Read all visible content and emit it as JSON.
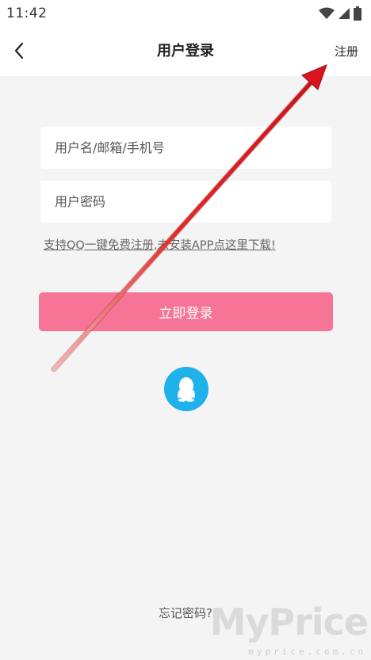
{
  "status_bar": {
    "time": "11:42",
    "icons": [
      "wifi-icon",
      "signal-icon",
      "battery-icon"
    ]
  },
  "nav": {
    "back_icon": "chevron-left-icon",
    "title": "用户登录",
    "register_label": "注册"
  },
  "form": {
    "username_placeholder": "用户名/邮箱/手机号",
    "username_value": "",
    "password_placeholder": "用户密码",
    "password_value": "",
    "qq_hint": "支持QQ一键免费注册,未安装APP点这里下载!",
    "login_label": "立即登录",
    "qq_login_icon": "qq-penguin-icon",
    "forgot_label": "忘记密码?"
  },
  "watermark": {
    "logo": "MyPrice",
    "domain": "myprice.com.cn"
  },
  "colors": {
    "accent_pink": "#f67495",
    "qq_blue": "#1fb1ea",
    "annotation_red": "#d9141e",
    "background": "#f4f4f4"
  }
}
